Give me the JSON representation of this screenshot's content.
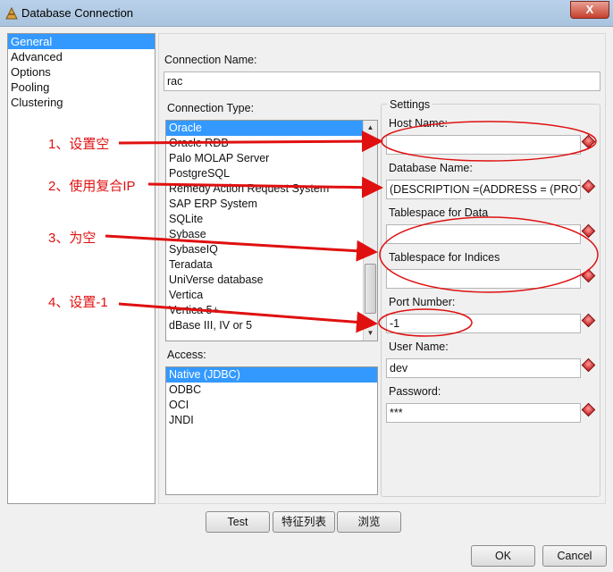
{
  "window": {
    "title": "Database Connection",
    "close_label": "X"
  },
  "nav": {
    "items": [
      "General",
      "Advanced",
      "Options",
      "Pooling",
      "Clustering"
    ],
    "selected": "General"
  },
  "connection_name": {
    "label": "Connection Name:",
    "value": "rac"
  },
  "connection_type": {
    "label": "Connection Type:",
    "items": [
      "Oracle",
      "Oracle RDB",
      "Palo MOLAP Server",
      "PostgreSQL",
      "Remedy Action Request System",
      "SAP ERP System",
      "SQLite",
      "Sybase",
      "SybaseIQ",
      "Teradata",
      "UniVerse database",
      "Vertica",
      "Vertica 5+",
      "dBase III, IV or 5"
    ],
    "selected": "Oracle"
  },
  "access": {
    "label": "Access:",
    "items": [
      "Native (JDBC)",
      "ODBC",
      "OCI",
      "JNDI"
    ],
    "selected": "Native (JDBC)"
  },
  "settings": {
    "legend": "Settings",
    "host_name": {
      "label": "Host Name:",
      "value": ""
    },
    "database_name": {
      "label": "Database Name:",
      "value": "(DESCRIPTION =(ADDRESS = (PROTOC"
    },
    "tablespace_data": {
      "label": "Tablespace for Data",
      "value": ""
    },
    "tablespace_indices": {
      "label": "Tablespace for Indices",
      "value": ""
    },
    "port_number": {
      "label": "Port Number:",
      "value": "-1"
    },
    "user_name": {
      "label": "User Name:",
      "value": "dev"
    },
    "password": {
      "label": "Password:",
      "value": "***"
    }
  },
  "buttons": {
    "test": "Test",
    "features": "特征列表",
    "browse": "浏览",
    "ok": "OK",
    "cancel": "Cancel"
  },
  "annotations": [
    "1、设置空",
    "2、使用复合IP",
    "3、为空",
    "4、设置-1"
  ],
  "colors": {
    "annotation": "#e01010",
    "selection": "#3399ff"
  }
}
